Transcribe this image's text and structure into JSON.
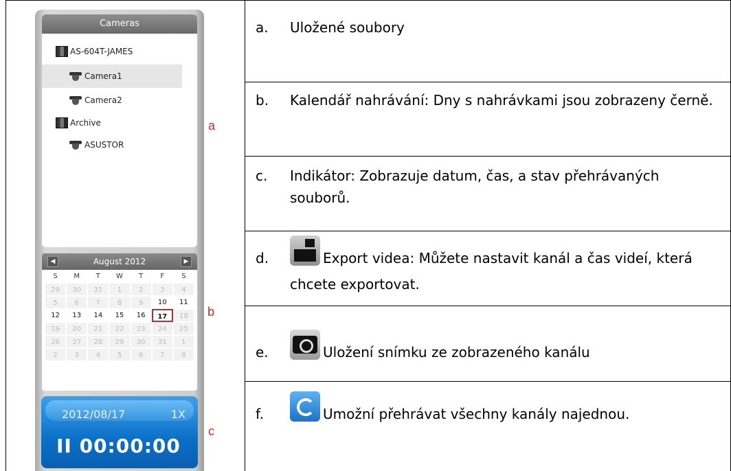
{
  "cameras_panel": {
    "title": "Cameras",
    "tree": [
      {
        "label": "AS-604T-JAMES",
        "icon": "server-icon"
      },
      {
        "label": "Camera1",
        "icon": "camera-icon",
        "selected": true
      },
      {
        "label": "Camera2",
        "icon": "camera-icon"
      },
      {
        "label": "Archive",
        "icon": "server-icon"
      },
      {
        "label": "ASUSTOR",
        "icon": "camera-icon"
      }
    ]
  },
  "calendar": {
    "month_label": "August 2012",
    "prev": "◀",
    "next": "▶",
    "weekdays": [
      "S",
      "M",
      "T",
      "W",
      "T",
      "F",
      "S"
    ],
    "weeks": [
      [
        "29",
        "30",
        "31",
        "1",
        "2",
        "3",
        "4"
      ],
      [
        "5",
        "6",
        "7",
        "8",
        "9",
        "10",
        "11"
      ],
      [
        "12",
        "13",
        "14",
        "15",
        "16",
        "17",
        "18"
      ],
      [
        "19",
        "20",
        "21",
        "22",
        "23",
        "24",
        "25"
      ],
      [
        "26",
        "27",
        "28",
        "29",
        "30",
        "31",
        "1"
      ],
      [
        "2",
        "3",
        "4",
        "5",
        "6",
        "7",
        "8"
      ]
    ],
    "recorded_days": [
      "10",
      "11",
      "12",
      "13",
      "14",
      "15",
      "16",
      "17"
    ],
    "today": "17"
  },
  "indicator": {
    "date": "2012/08/17",
    "speed": "1X",
    "time": "II 00:00:00"
  },
  "markers": {
    "a": "a",
    "b": "b",
    "c": "c"
  },
  "rows": [
    {
      "label": "a.",
      "text": "Uložené soubory"
    },
    {
      "label": "b.",
      "text": "Kalendář nahrávání: Dny s nahrávkami jsou zobrazeny černě."
    },
    {
      "label": "c.",
      "text": "Indikátor: Zobrazuje datum, čas, a stav přehrávaných souborů."
    },
    {
      "label": "d.",
      "text": "Export videa: Můžete nastavit kanál a čas videí, která chcete exportovat."
    },
    {
      "label": "e.",
      "text": "Uložení snímku ze zobrazeného kanálu"
    },
    {
      "label": "f.",
      "text": "Umožní přehrávat všechny kanály najednou."
    }
  ],
  "colors": {
    "marker": "#e0241c",
    "indicator": "#0a6fc7"
  }
}
